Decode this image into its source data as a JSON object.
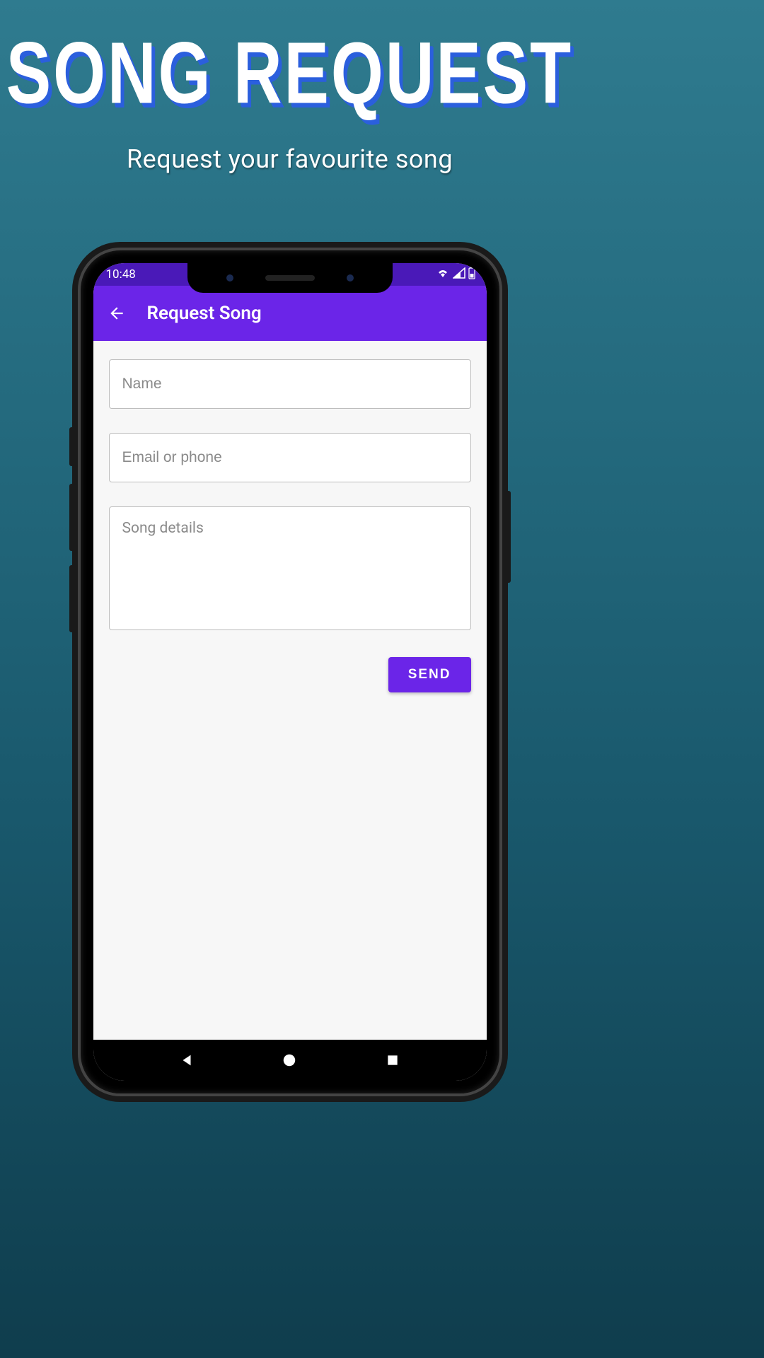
{
  "promo": {
    "title": "SONG REQUEST",
    "subtitle": "Request your favourite song"
  },
  "status": {
    "time": "10:48"
  },
  "appbar": {
    "title": "Request Song"
  },
  "form": {
    "name_placeholder": "Name",
    "contact_placeholder": "Email or phone",
    "details_placeholder": "Song details",
    "send_label": "SEND"
  },
  "colors": {
    "accent": "#6b25e8",
    "status_bar": "#4a19b8"
  }
}
